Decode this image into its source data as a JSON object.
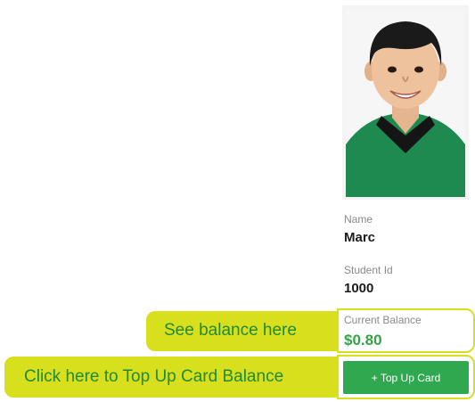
{
  "student": {
    "photo_alt": "Student photo",
    "name_label": "Name",
    "name_value": "Marc",
    "id_label": "Student Id",
    "id_value": "1000",
    "balance_label": "Current Balance",
    "balance_value": "$0.80"
  },
  "actions": {
    "topup_label": "+ Top Up Card"
  },
  "callouts": {
    "balance_hint": "See balance here",
    "topup_hint": "Click here to Top Up Card Balance"
  },
  "colors": {
    "highlight": "#d8df1c",
    "callout_text": "#1f8a3a",
    "balance_green": "#35a24a",
    "button_green": "#2fa84f"
  }
}
